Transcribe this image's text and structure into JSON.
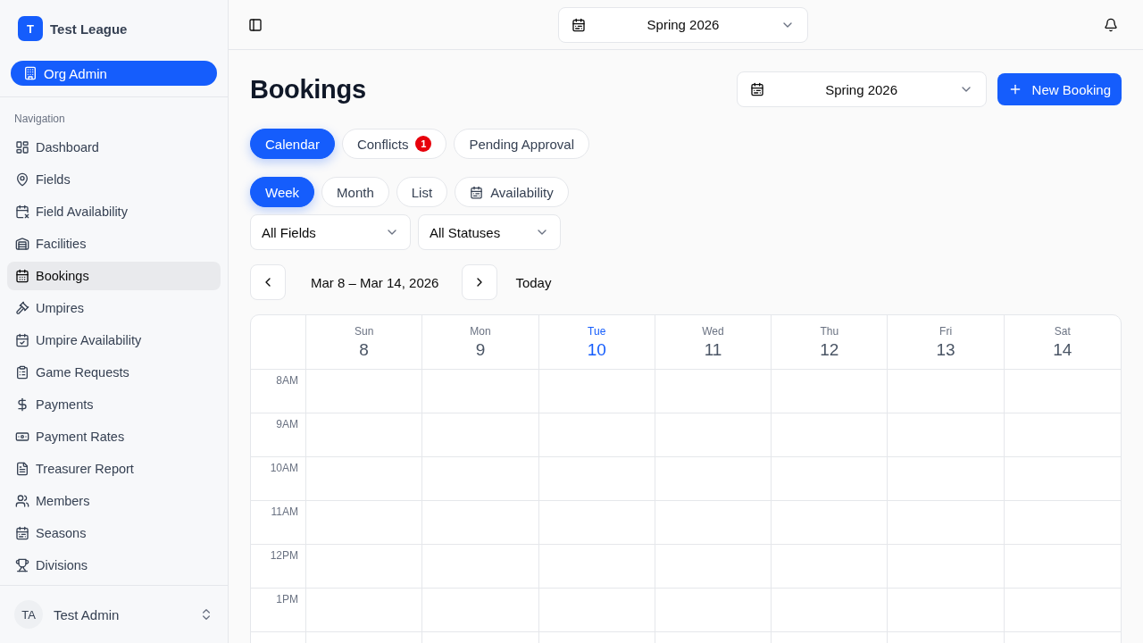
{
  "sidebar": {
    "league": {
      "initial": "T",
      "name": "Test League"
    },
    "role": {
      "label": "Org Admin"
    },
    "section_label": "Navigation",
    "items": [
      {
        "label": "Dashboard",
        "selected": false
      },
      {
        "label": "Fields",
        "selected": false
      },
      {
        "label": "Field Availability",
        "selected": false
      },
      {
        "label": "Facilities",
        "selected": false
      },
      {
        "label": "Bookings",
        "selected": true
      },
      {
        "label": "Umpires",
        "selected": false
      },
      {
        "label": "Umpire Availability",
        "selected": false
      },
      {
        "label": "Game Requests",
        "selected": false
      },
      {
        "label": "Payments",
        "selected": false
      },
      {
        "label": "Payment Rates",
        "selected": false
      },
      {
        "label": "Treasurer Report",
        "selected": false
      },
      {
        "label": "Members",
        "selected": false
      },
      {
        "label": "Seasons",
        "selected": false
      },
      {
        "label": "Divisions",
        "selected": false
      }
    ],
    "user": {
      "initials": "TA",
      "name": "Test Admin"
    }
  },
  "topbar": {
    "season_select": {
      "value": "Spring 2026"
    }
  },
  "header": {
    "title": "Bookings",
    "season_select": {
      "value": "Spring 2026"
    },
    "new_button": {
      "label": "New Booking"
    }
  },
  "tabs": [
    {
      "label": "Calendar",
      "selected": true
    },
    {
      "label": "Conflicts",
      "selected": false,
      "badge": "1"
    },
    {
      "label": "Pending Approval",
      "selected": false
    }
  ],
  "views": [
    {
      "label": "Week",
      "selected": true,
      "kind": "text"
    },
    {
      "label": "Month",
      "selected": false,
      "kind": "text"
    },
    {
      "label": "List",
      "selected": false,
      "kind": "text"
    },
    {
      "label": "Availability",
      "selected": false,
      "kind": "icon"
    }
  ],
  "filters": [
    {
      "value": "All Fields"
    },
    {
      "value": "All Statuses"
    }
  ],
  "date_nav": {
    "range": "Mar 8 – Mar 14, 2026",
    "today_button": "Today"
  },
  "calendar": {
    "days": [
      {
        "weekday": "Sun",
        "date": "8",
        "today": false
      },
      {
        "weekday": "Mon",
        "date": "9",
        "today": false
      },
      {
        "weekday": "Tue",
        "date": "10",
        "today": true
      },
      {
        "weekday": "Wed",
        "date": "11",
        "today": false
      },
      {
        "weekday": "Thu",
        "date": "12",
        "today": false
      },
      {
        "weekday": "Fri",
        "date": "13",
        "today": false
      },
      {
        "weekday": "Sat",
        "date": "14",
        "today": false
      }
    ],
    "hours": [
      "8AM",
      "9AM",
      "10AM",
      "11AM",
      "12PM",
      "1PM"
    ]
  }
}
